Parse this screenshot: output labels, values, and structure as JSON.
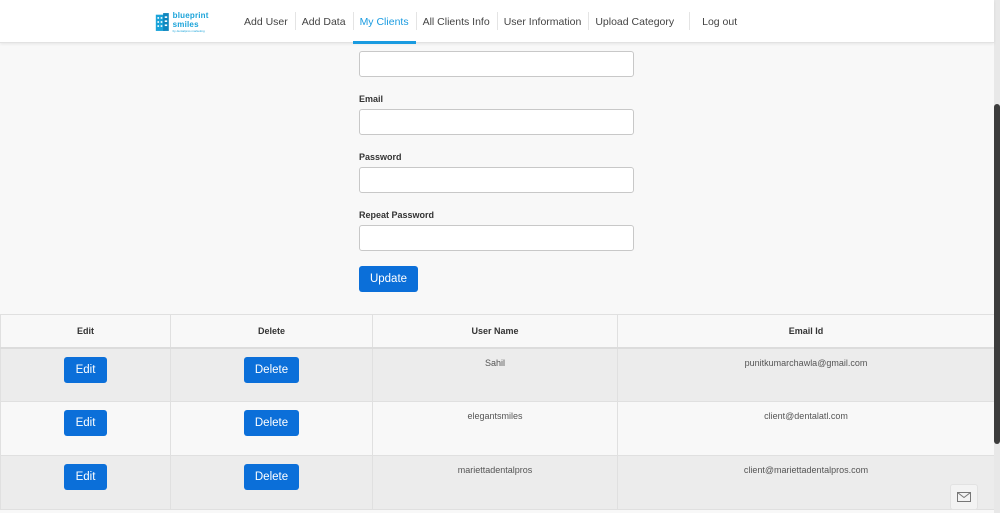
{
  "brand": {
    "name": "blueprint smiles",
    "tagline": "by dentalpros marketing",
    "accent": "#1a9be0",
    "button_color": "#0b6fd9"
  },
  "nav": {
    "items": [
      {
        "label": "Add User"
      },
      {
        "label": "Add Data"
      },
      {
        "label": "My Clients"
      },
      {
        "label": "All Clients Info"
      },
      {
        "label": "User Information"
      },
      {
        "label": "Upload Category"
      }
    ],
    "active": "My Clients",
    "logout": "Log out"
  },
  "form": {
    "first_input_value": "",
    "email_label": "Email",
    "email_value": "",
    "password_label": "Password",
    "password_value": "",
    "repeat_password_label": "Repeat Password",
    "repeat_password_value": "",
    "update_label": "Update"
  },
  "table": {
    "headers": [
      "Edit",
      "Delete",
      "User Name",
      "Email Id"
    ],
    "edit_label": "Edit",
    "delete_label": "Delete",
    "rows": [
      {
        "username": "Sahil",
        "email": "punitkumarchawla@gmail.com"
      },
      {
        "username": "elegantsmiles",
        "email": "client@dentalatl.com"
      },
      {
        "username": "mariettadentalpros",
        "email": "client@mariettadentalpros.com"
      }
    ]
  },
  "icons": {
    "logo": "building-logo-icon",
    "chat": "envelope-icon"
  }
}
